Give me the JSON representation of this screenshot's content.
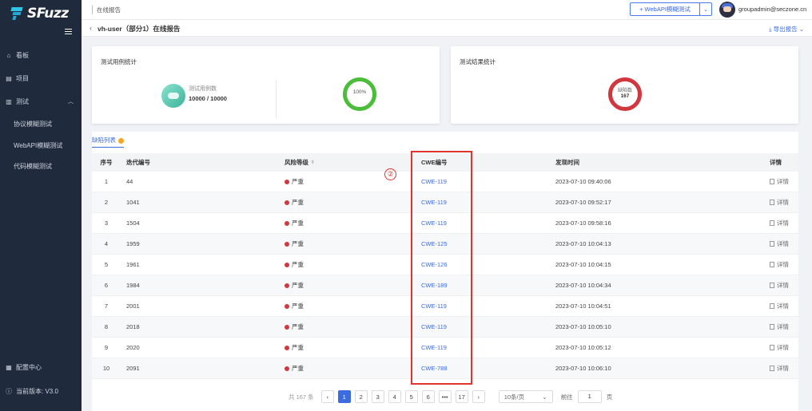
{
  "sidebar": {
    "logo_text": "SFuzz",
    "items": [
      {
        "label": "看板",
        "icon": "home-icon"
      },
      {
        "label": "项目",
        "icon": "project-icon"
      },
      {
        "label": "测试",
        "icon": "test-icon"
      }
    ],
    "subitems": [
      "协议模糊测试",
      "WebAPI模糊测试",
      "代码模糊测试"
    ],
    "config_label": "配置中心",
    "version_label": "当前版本: V3.0"
  },
  "topbar": {
    "breadcrumb": "在线报告",
    "webapi_button": "+ WebAPI模糊测试",
    "user_email": "groupadmin@seczone.cn"
  },
  "page": {
    "title": "vh-user（部分1）在线报告",
    "export_label": "导出报告"
  },
  "case_stats": {
    "title": "测试用例统计",
    "count_label": "测试用例数",
    "count_value": "10000 / 10000",
    "percent": "100%"
  },
  "result_stats": {
    "title": "测试结果统计",
    "defect_label": "缺陷数",
    "defect_value": "167"
  },
  "defects": {
    "tab_label": "缺陷列表",
    "columns": {
      "index": "序号",
      "iteration": "迭代编号",
      "risk": "风险等级",
      "cwe": "CWE编号",
      "time": "发现时间",
      "detail": "详情"
    },
    "rows": [
      {
        "index": "1",
        "iteration": "44",
        "risk": "严重",
        "cwe": "CWE-119",
        "time": "2023-07-10 09:40:06",
        "detail": "详情"
      },
      {
        "index": "2",
        "iteration": "1041",
        "risk": "严重",
        "cwe": "CWE-119",
        "time": "2023-07-10 09:52:17",
        "detail": "详情"
      },
      {
        "index": "3",
        "iteration": "1504",
        "risk": "严重",
        "cwe": "CWE-119",
        "time": "2023-07-10 09:58:16",
        "detail": "详情"
      },
      {
        "index": "4",
        "iteration": "1959",
        "risk": "严重",
        "cwe": "CWE-125",
        "time": "2023-07-10 10:04:13",
        "detail": "详情"
      },
      {
        "index": "5",
        "iteration": "1961",
        "risk": "严重",
        "cwe": "CWE-126",
        "time": "2023-07-10 10:04:15",
        "detail": "详情"
      },
      {
        "index": "6",
        "iteration": "1984",
        "risk": "严重",
        "cwe": "CWE-189",
        "time": "2023-07-10 10:04:34",
        "detail": "详情"
      },
      {
        "index": "7",
        "iteration": "2001",
        "risk": "严重",
        "cwe": "CWE-119",
        "time": "2023-07-10 10:04:51",
        "detail": "详情"
      },
      {
        "index": "8",
        "iteration": "2018",
        "risk": "严重",
        "cwe": "CWE-119",
        "time": "2023-07-10 10:05:10",
        "detail": "详情"
      },
      {
        "index": "9",
        "iteration": "2020",
        "risk": "严重",
        "cwe": "CWE-119",
        "time": "2023-07-10 10:05:12",
        "detail": "详情"
      },
      {
        "index": "10",
        "iteration": "2091",
        "risk": "严重",
        "cwe": "CWE-788",
        "time": "2023-07-10 10:06:10",
        "detail": "详情"
      }
    ]
  },
  "annotation": {
    "marker": "②"
  },
  "pagination": {
    "total": "共 167 条",
    "pages": [
      "1",
      "2",
      "3",
      "4",
      "5",
      "6",
      "•••",
      "17"
    ],
    "prev": "‹",
    "next": "›",
    "page_size": "10条/页",
    "goto_label": "前往",
    "goto_value": "1",
    "page_unit": "页"
  },
  "colors": {
    "accent": "#3a6be0",
    "danger": "#d1373f",
    "success": "#4bbd3a",
    "sidebar": "#1f2a3d"
  }
}
